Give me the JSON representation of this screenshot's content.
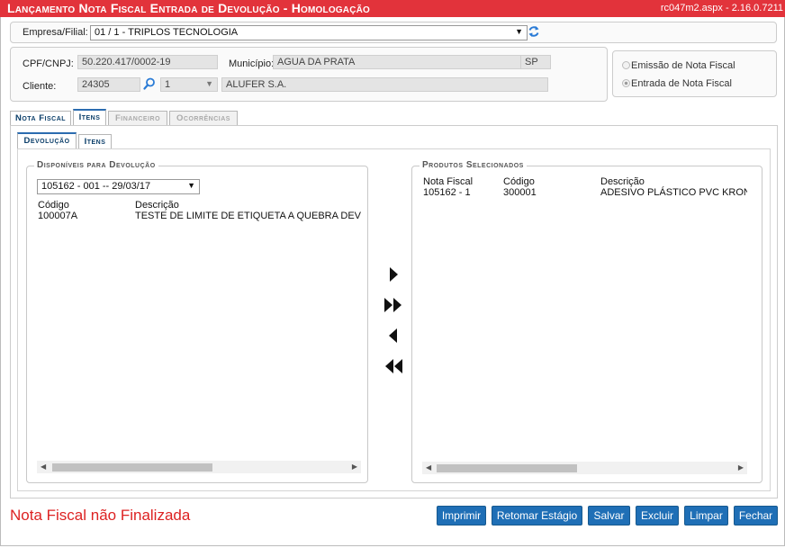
{
  "window": {
    "title": "Lançamento Nota Fiscal Entrada de Devolução  - Homologação",
    "version": "rc047m2.aspx - 2.16.0.7211"
  },
  "header": {
    "empresa_label": "Empresa/Filial:",
    "empresa_value": "01 / 1 - TRIPLOS TECNOLOGIA"
  },
  "details": {
    "cpf_label": "CPF/CNPJ:",
    "cpf_value": "50.220.417/0002-19",
    "municipio_label": "Município:",
    "municipio_value": "AGUA DA PRATA",
    "uf_value": "SP",
    "cliente_label": "Cliente:",
    "cliente_code": "24305",
    "cliente_seq": "1",
    "cliente_name": "ALUFER S.A."
  },
  "mode": {
    "option_emissao": "Emissão de Nota Fiscal",
    "option_entrada": "Entrada de Nota Fiscal",
    "selected": "entrada"
  },
  "tabs": {
    "main": [
      "Nota Fiscal",
      "Itens",
      "Financeiro",
      "Ocorrências"
    ],
    "sub": [
      "Devolução",
      "Itens"
    ]
  },
  "disponiveis": {
    "legend": "Disponíveis para Devolução",
    "select_value": "105162 - 001 -- 29/03/17",
    "col_codigo": "Código",
    "col_descricao": "Descrição",
    "rows": [
      {
        "codigo": "100007A",
        "descricao": "TESTE DE LIMITE DE ETIQUETA A QUEBRA DEVE AC"
      }
    ]
  },
  "selecionados": {
    "legend": "Produtos Selecionados",
    "col_nota": "Nota Fiscal",
    "col_codigo": "Código",
    "col_descricao": "Descrição",
    "rows": [
      {
        "nota": "105162 - 1",
        "codigo": "300001",
        "descricao": "ADESIVO PLÁSTICO PVC KRONA"
      }
    ]
  },
  "footer": {
    "status": "Nota Fiscal não Finalizada",
    "buttons": {
      "imprimir": "Imprimir",
      "retomar": "Retomar Estágio",
      "salvar": "Salvar",
      "excluir": "Excluir",
      "limpar": "Limpar",
      "fechar": "Fechar"
    }
  },
  "colors": {
    "title_bar": "#e2333b",
    "button": "#1f6fb6",
    "status_text": "#dd2222",
    "refresh_icon": "#2a7bd6",
    "search_icon": "#2a7bd6"
  },
  "icons": {
    "refresh": "refresh-icon",
    "search": "search-icon",
    "move_right": "move-right-icon",
    "move_all_right": "move-all-right-icon",
    "move_left": "move-left-icon",
    "move_all_left": "move-all-left-icon"
  }
}
